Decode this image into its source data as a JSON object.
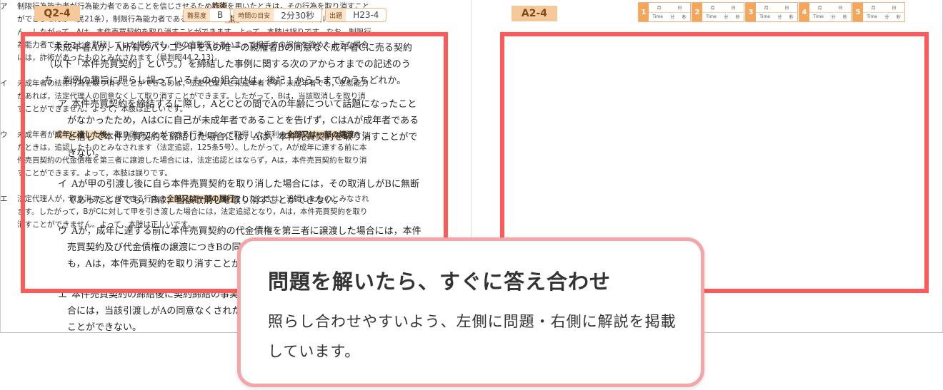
{
  "question_page": {
    "tab": "Q2-4",
    "meta": [
      {
        "key": "難易度",
        "value": "B"
      },
      {
        "key": "時間の目安",
        "value": "2分30秒"
      },
      {
        "key": "出題",
        "value": "H23-4"
      }
    ],
    "stem": "未成年者Aが，A所有のパソコン甲をAの唯一の親権者Bの同意なく成年者Cに売る契約（以下「本件売買契約」という。）を締結した事例に関する次のアからオまでの記述のうち，判例の趣旨に照らし誤っているものの組合せは，後記１から５までのうちどれか。",
    "items": [
      {
        "label": "ア",
        "text": "本件売買契約を締結するに際し，AとCとの間でAの年齢について話題になったことがなかったため，AはCに自己が未成年者であることを告げず，CはAが成年者であると信じて本件売買契約を締結した場合には，Aは，本件売買契約を取り消すことができない。"
      },
      {
        "label": "イ",
        "text": "Aが甲の引渡し後に自ら本件売買契約を取り消した場合には，その取消しがBに無断であったときでも，Bは，当該取消しを取り消すことができない。"
      },
      {
        "label": "ウ",
        "text": "Aが，成年に達する前に本件売買契約の代金債権を第三者に譲渡した場合には，本件売買契約及び代金債権の譲渡につきBの同意がなく，かつ，追認がなかったときでも，Aは，本件売買契約を取り消すことができない。"
      },
      {
        "label": "エ",
        "text": "本件売買契約の締結後に契約締結の事実を知ったBが，Cに対して甲を引き渡した場合には，当該引渡しがAの同意なくされたときでも，Aは，本件売買契約を取り消すことができない。"
      }
    ]
  },
  "answer_page": {
    "tab": "A2-4",
    "time_log": {
      "entries": [
        "1",
        "2",
        "3",
        "4",
        "5"
      ],
      "date_labels": [
        "月",
        "日"
      ],
      "time_labels": [
        "Time",
        "分",
        "秒"
      ]
    },
    "items": [
      {
        "label": "ア",
        "parts": [
          "制限行為能力者が行為能力者であることを信じさせるため",
          "詐術",
          "を用いたときは，その行為を取り消すことができませんが（民21条），制限行為能力者であることを単に",
          "黙秘",
          "していただけでは，詐術にあたりません。したがって，Aは，本件売買契約を取り消すことができます。よって，本肢は誤りです。なお，制限行為能力者であることを黙秘していた場合でも，他の言動等とあいまって相手方の誤信を強めたような場合には，詐術があったものとみなされます（最判昭44.2.13）。"
        ]
      },
      {
        "label": "イ",
        "parts": [
          "未成年者の法律行為を取り消すことができるのは，法定代理人と未成年者です。未成年者でも，意思能力があれば，法定代理人の同意なくして取り消すことができます。したがって，Bは，当該取消しを取り消すことができません。よって，本肢は正しいです。"
        ]
      },
      {
        "label": "ウ",
        "parts": [
          "未成年者が",
          "成年に達した後",
          "，取り消すことができる行為によって取得した権利の",
          "全部又は一部の譲渡",
          "をしたときは，追認したものとみなされます（法定追認，125条5号）。したがって，Aが成年に達する前に本件売買契約の代金債権を第三者に譲渡した場合には，法定追認とはならず，Aは，本件売買契約を取り消すことができます。よって，本肢は誤りです。"
        ]
      },
      {
        "label": "エ",
        "parts": [
          "法定代理人が，取り消すことができる行為の",
          "全部又は一部の履行",
          "をしたときは，追認したものとみなされます。したがって，BがCに対して甲を引き渡した場合には，法定追認となり，Aは，本件売買契約を取り消すことができません。よって，本肢は正しいです。"
        ]
      }
    ]
  },
  "callout": {
    "title": "問題を解いたら、すぐに答え合わせ",
    "body": "照らし合わせやすいよう、左側に問題・右側に解説を掲載しています。"
  },
  "colors": {
    "frame": "#ff5a5a",
    "callout_border": "#f4a5a8",
    "tab": "#f6c99a",
    "highlight": "#fbe0bd"
  }
}
